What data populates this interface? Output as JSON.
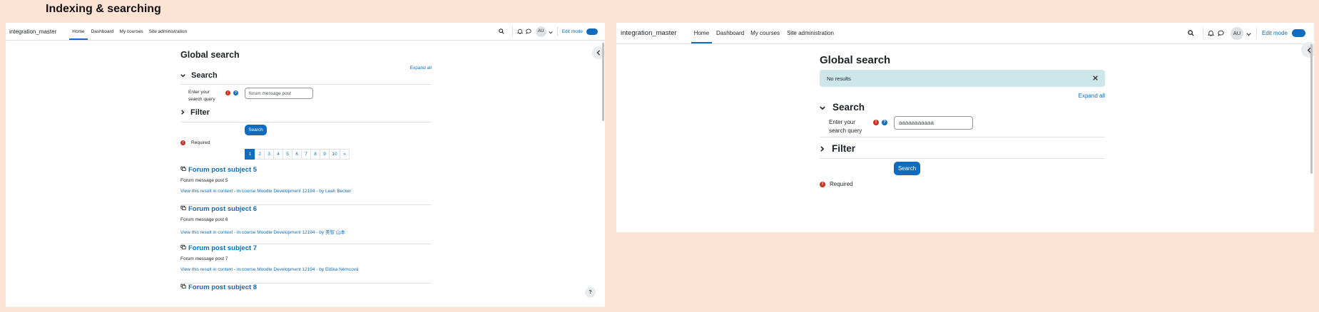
{
  "heading": "Indexing & searching",
  "left": {
    "nav": {
      "brand": "integration_master",
      "links": [
        "Home",
        "Dashboard",
        "My courses",
        "Site administration"
      ],
      "avatar": "AU",
      "edit_mode": "Edit mode",
      "edit_mode_on": true,
      "icons": [
        "search-icon",
        "bell-icon",
        "chat-icon",
        "chevron-down-icon"
      ]
    },
    "page_title": "Global search",
    "expand_all": "Expand all",
    "search_section": "Search",
    "query_label_1": "Enter your",
    "query_label_2": "search query",
    "query_value": "forum message post",
    "filter_section": "Filter",
    "search_button": "Search",
    "required": "Required",
    "pages": [
      "1",
      "2",
      "3",
      "4",
      "5",
      "6",
      "7",
      "8",
      "9",
      "10",
      "»"
    ],
    "active_page": "1",
    "results": [
      {
        "title": "Forum post subject 5",
        "body": "Forum message post 5",
        "ctx": "View this result in context",
        "course": "in course Moodle Development 12194",
        "by": "by Leah Becker"
      },
      {
        "title": "Forum post subject 6",
        "body": "Forum message post 6",
        "ctx": "View this result in context",
        "course": "in course Moodle Development 12194",
        "by": "by 美智 山本"
      },
      {
        "title": "Forum post subject 7",
        "body": "Forum message post 7",
        "ctx": "View this result in context",
        "course": "in course Moodle Development 12194",
        "by": "by Eliška Němcová"
      },
      {
        "title": "Forum post subject 8"
      }
    ],
    "help_fab": "?"
  },
  "right": {
    "nav": {
      "brand": "integration_master",
      "links": [
        "Home",
        "Dashboard",
        "My courses",
        "Site administration"
      ],
      "avatar": "AU",
      "edit_mode": "Edit mode",
      "edit_mode_on": true
    },
    "page_title": "Global search",
    "alert": "No results",
    "expand_all": "Expand all",
    "search_section": "Search",
    "query_label_1": "Enter your",
    "query_label_2": "search query",
    "query_value": "aaaaaaaaaaa",
    "filter_section": "Filter",
    "search_button": "Search",
    "required": "Required"
  }
}
